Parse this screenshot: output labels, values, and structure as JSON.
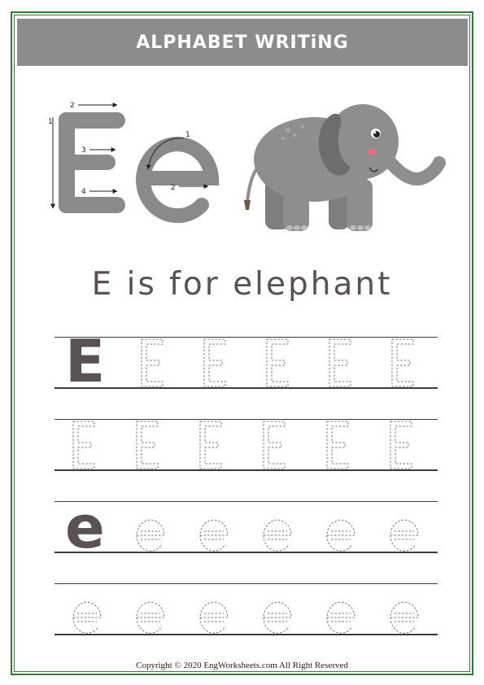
{
  "header": {
    "title": "ALPHABET WRITiNG"
  },
  "hero": {
    "upper_letter": "E",
    "lower_letter": "e",
    "upper_stroke_numbers": [
      "1",
      "2",
      "3",
      "4"
    ],
    "lower_stroke_numbers": [
      "1",
      "2"
    ]
  },
  "caption": "E is for elephant",
  "practice": {
    "upper_model": "E",
    "lower_model": "e"
  },
  "footer": {
    "copyright": "Copyright © 2020 EngWorksheets.com All Right Reserved"
  },
  "colors": {
    "banner": "#8c8c8c",
    "letter_gray": "#8a8a8a",
    "caption": "#5a5155",
    "model_letter": "#5a5155",
    "frame_green": "#2e7d32",
    "elephant_body": "#8e8e8e",
    "elephant_dark": "#6e6e6e"
  }
}
